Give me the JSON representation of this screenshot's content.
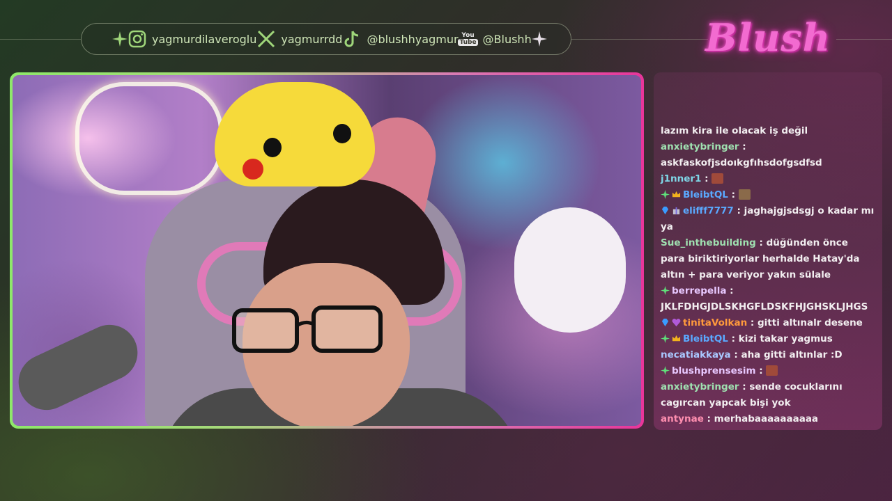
{
  "socials": [
    {
      "platform_icon": "instagram-icon",
      "handle": "yagmurdilaveroglu"
    },
    {
      "platform_icon": "x-icon",
      "handle": "yagmurrdd"
    },
    {
      "platform_icon": "tiktok-icon",
      "handle": "@blushhyagmur"
    },
    {
      "platform_icon": "youtube-icon",
      "handle": "@Blushh",
      "icon_text_top": "You",
      "icon_text_bottom": "Tube"
    }
  ],
  "logo": "Blush",
  "colors": {
    "accent_green": "#8ee86a",
    "accent_pink": "#e8359a",
    "logo_pink": "#f26bd0"
  },
  "chat": {
    "messages": [
      {
        "user": "",
        "user_color": "#f2eef0",
        "badges": [],
        "text": "lazım kira ile olacak iş değil"
      },
      {
        "user": "anxietybringer",
        "user_color": "#9fe0b0",
        "badges": [],
        "text": "askfaskofjsdoıkgfıhsdofgsdfsd"
      },
      {
        "user": "j1nner1",
        "user_color": "#7fd8e8",
        "badges": [],
        "text": "",
        "emote": "emote-icon"
      },
      {
        "user": "BleibtQL",
        "user_color": "#5aa9ff",
        "badges": [
          "sparkle-badge-icon",
          "crown-badge-icon"
        ],
        "text": "",
        "emote": "emote-icon"
      },
      {
        "user": "elifff7777",
        "user_color": "#5aa9ff",
        "badges": [
          "gem-badge-icon",
          "gift-badge-icon"
        ],
        "text": "jaghajgjsdsgj o kadar mı ya"
      },
      {
        "user": "Sue_inthebuilding",
        "user_color": "#9fe0b0",
        "badges": [],
        "text": "düğünden önce para biriktiriyorlar herhalde Hatay'da altın + para veriyor yakın sülale"
      },
      {
        "user": "berrepella",
        "user_color": "#e8c8ff",
        "badges": [
          "sparkle-badge-icon"
        ],
        "text": "JKLFDHGJDLSKHGFLDSKFHJGHSKLJHGS"
      },
      {
        "user": "tinitaVolkan",
        "user_color": "#ff9a3c",
        "badges": [
          "gem-badge-icon",
          "heart-badge-icon"
        ],
        "text": "gitti altınalr desene"
      },
      {
        "user": "BleibtQL",
        "user_color": "#5aa9ff",
        "badges": [
          "sparkle-badge-icon",
          "crown-badge-icon"
        ],
        "text": "kizi takar yagmus"
      },
      {
        "user": "necatiakkaya",
        "user_color": "#a9c8ff",
        "badges": [],
        "text": "aha gitti altınlar :D"
      },
      {
        "user": "blushprensesim",
        "user_color": "#e8c8ff",
        "badges": [
          "sparkle-badge-icon"
        ],
        "text": "",
        "emote": "emote-icon"
      },
      {
        "user": "anxietybringer",
        "user_color": "#9fe0b0",
        "badges": [],
        "text": "sende cocuklarını cagırcan yapcak bişi yok"
      },
      {
        "user": "antynae",
        "user_color": "#ff8fb0",
        "badges": [],
        "text": "merhabaaaaaaaaaa"
      }
    ]
  }
}
